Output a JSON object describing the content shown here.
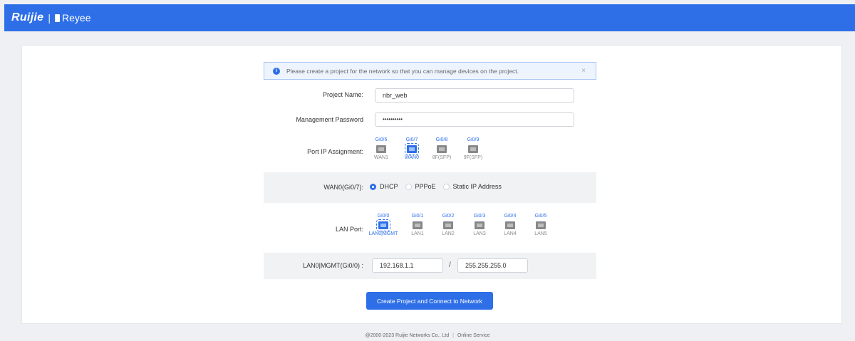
{
  "header": {
    "brand": "Ruijie",
    "brand2": "Reyee"
  },
  "alert": {
    "text": "Please create a project for the network so that you can manage devices on the project.",
    "close": "×"
  },
  "form": {
    "project_name_label": "Project Name:",
    "project_name_value": "nbr_web",
    "password_label": "Management Password",
    "password_value": "••••••••••",
    "port_ip_label": "Port IP Assignment:",
    "wan_ports": [
      {
        "name": "Gi0/6",
        "label": "WAN1",
        "selected": false
      },
      {
        "name": "Gi0/7",
        "label": "WAN0",
        "selected": true
      },
      {
        "name": "Gi0/8",
        "label": "8F(SFP)",
        "selected": false
      },
      {
        "name": "Gi0/9",
        "label": "9F(SFP)",
        "selected": false
      }
    ],
    "wan_mode_label": "WAN0(Gi0/7):",
    "wan_modes": {
      "dhcp": "DHCP",
      "pppoe": "PPPoE",
      "static": "Static IP Address"
    },
    "wan_mode_selected": "DHCP",
    "lan_port_label": "LAN Port:",
    "lan_ports": [
      {
        "name": "Gi0/0",
        "label": "LAN0|MGMT",
        "selected": true
      },
      {
        "name": "Gi0/1",
        "label": "LAN1",
        "selected": false
      },
      {
        "name": "Gi0/2",
        "label": "LAN2",
        "selected": false
      },
      {
        "name": "Gi0/3",
        "label": "LAN3",
        "selected": false
      },
      {
        "name": "Gi0/4",
        "label": "LAN4",
        "selected": false
      },
      {
        "name": "Gi0/5",
        "label": "LAN5",
        "selected": false
      }
    ],
    "lan_ip_label": "LAN0|MGMT(Gi0/0) :",
    "lan_ip": "192.168.1.1",
    "lan_sep": "/",
    "lan_mask": "255.255.255.0",
    "submit": "Create Project and Connect to Network"
  },
  "footer": {
    "copyright": "@2000-2023 Ruijie Networks Co., Ltd",
    "sep": "|",
    "link": "Online Service"
  },
  "colors": {
    "primary": "#2e6fe8"
  }
}
